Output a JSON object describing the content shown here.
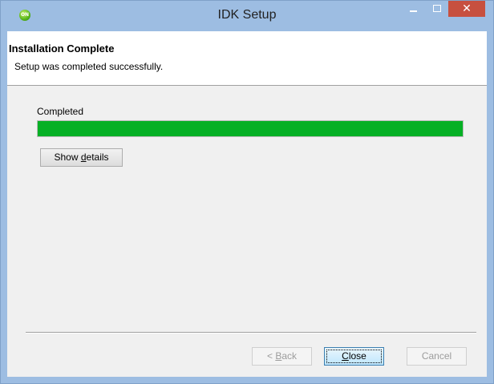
{
  "window": {
    "title": "IDK Setup",
    "icon_text": "ON",
    "close_glyph": "✕"
  },
  "header": {
    "title": "Installation Complete",
    "subtitle": "Setup was completed successfully."
  },
  "status": {
    "label": "Completed",
    "progress_percent": 100,
    "progress_color": "#06b025"
  },
  "buttons": {
    "details": {
      "pre": "Show ",
      "accel": "d",
      "post": "etails"
    },
    "back": {
      "pre": "< ",
      "accel": "B",
      "post": "ack",
      "enabled": false
    },
    "close": {
      "pre": "",
      "accel": "C",
      "post": "lose",
      "enabled": true
    },
    "cancel": {
      "label": "Cancel",
      "enabled": false
    }
  },
  "icons": {
    "app": "setup-app-icon",
    "minimize": "minimize-icon",
    "maximize": "maximize-icon",
    "close": "close-icon"
  }
}
